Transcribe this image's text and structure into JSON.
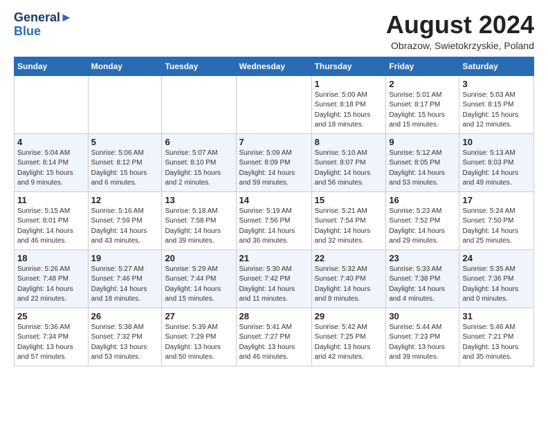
{
  "header": {
    "logo_line1": "General",
    "logo_line2": "Blue",
    "month_title": "August 2024",
    "location": "Obrazow, Swietokrzyskie, Poland"
  },
  "weekdays": [
    "Sunday",
    "Monday",
    "Tuesday",
    "Wednesday",
    "Thursday",
    "Friday",
    "Saturday"
  ],
  "weeks": [
    [
      {
        "day": "",
        "info": ""
      },
      {
        "day": "",
        "info": ""
      },
      {
        "day": "",
        "info": ""
      },
      {
        "day": "",
        "info": ""
      },
      {
        "day": "1",
        "info": "Sunrise: 5:00 AM\nSunset: 8:18 PM\nDaylight: 15 hours\nand 18 minutes."
      },
      {
        "day": "2",
        "info": "Sunrise: 5:01 AM\nSunset: 8:17 PM\nDaylight: 15 hours\nand 15 minutes."
      },
      {
        "day": "3",
        "info": "Sunrise: 5:03 AM\nSunset: 8:15 PM\nDaylight: 15 hours\nand 12 minutes."
      }
    ],
    [
      {
        "day": "4",
        "info": "Sunrise: 5:04 AM\nSunset: 8:14 PM\nDaylight: 15 hours\nand 9 minutes."
      },
      {
        "day": "5",
        "info": "Sunrise: 5:06 AM\nSunset: 8:12 PM\nDaylight: 15 hours\nand 6 minutes."
      },
      {
        "day": "6",
        "info": "Sunrise: 5:07 AM\nSunset: 8:10 PM\nDaylight: 15 hours\nand 2 minutes."
      },
      {
        "day": "7",
        "info": "Sunrise: 5:09 AM\nSunset: 8:09 PM\nDaylight: 14 hours\nand 59 minutes."
      },
      {
        "day": "8",
        "info": "Sunrise: 5:10 AM\nSunset: 8:07 PM\nDaylight: 14 hours\nand 56 minutes."
      },
      {
        "day": "9",
        "info": "Sunrise: 5:12 AM\nSunset: 8:05 PM\nDaylight: 14 hours\nand 53 minutes."
      },
      {
        "day": "10",
        "info": "Sunrise: 5:13 AM\nSunset: 8:03 PM\nDaylight: 14 hours\nand 49 minutes."
      }
    ],
    [
      {
        "day": "11",
        "info": "Sunrise: 5:15 AM\nSunset: 8:01 PM\nDaylight: 14 hours\nand 46 minutes."
      },
      {
        "day": "12",
        "info": "Sunrise: 5:16 AM\nSunset: 7:59 PM\nDaylight: 14 hours\nand 43 minutes."
      },
      {
        "day": "13",
        "info": "Sunrise: 5:18 AM\nSunset: 7:58 PM\nDaylight: 14 hours\nand 39 minutes."
      },
      {
        "day": "14",
        "info": "Sunrise: 5:19 AM\nSunset: 7:56 PM\nDaylight: 14 hours\nand 36 minutes."
      },
      {
        "day": "15",
        "info": "Sunrise: 5:21 AM\nSunset: 7:54 PM\nDaylight: 14 hours\nand 32 minutes."
      },
      {
        "day": "16",
        "info": "Sunrise: 5:23 AM\nSunset: 7:52 PM\nDaylight: 14 hours\nand 29 minutes."
      },
      {
        "day": "17",
        "info": "Sunrise: 5:24 AM\nSunset: 7:50 PM\nDaylight: 14 hours\nand 25 minutes."
      }
    ],
    [
      {
        "day": "18",
        "info": "Sunrise: 5:26 AM\nSunset: 7:48 PM\nDaylight: 14 hours\nand 22 minutes."
      },
      {
        "day": "19",
        "info": "Sunrise: 5:27 AM\nSunset: 7:46 PM\nDaylight: 14 hours\nand 18 minutes."
      },
      {
        "day": "20",
        "info": "Sunrise: 5:29 AM\nSunset: 7:44 PM\nDaylight: 14 hours\nand 15 minutes."
      },
      {
        "day": "21",
        "info": "Sunrise: 5:30 AM\nSunset: 7:42 PM\nDaylight: 14 hours\nand 11 minutes."
      },
      {
        "day": "22",
        "info": "Sunrise: 5:32 AM\nSunset: 7:40 PM\nDaylight: 14 hours\nand 8 minutes."
      },
      {
        "day": "23",
        "info": "Sunrise: 5:33 AM\nSunset: 7:38 PM\nDaylight: 14 hours\nand 4 minutes."
      },
      {
        "day": "24",
        "info": "Sunrise: 5:35 AM\nSunset: 7:36 PM\nDaylight: 14 hours\nand 0 minutes."
      }
    ],
    [
      {
        "day": "25",
        "info": "Sunrise: 5:36 AM\nSunset: 7:34 PM\nDaylight: 13 hours\nand 57 minutes."
      },
      {
        "day": "26",
        "info": "Sunrise: 5:38 AM\nSunset: 7:32 PM\nDaylight: 13 hours\nand 53 minutes."
      },
      {
        "day": "27",
        "info": "Sunrise: 5:39 AM\nSunset: 7:29 PM\nDaylight: 13 hours\nand 50 minutes."
      },
      {
        "day": "28",
        "info": "Sunrise: 5:41 AM\nSunset: 7:27 PM\nDaylight: 13 hours\nand 46 minutes."
      },
      {
        "day": "29",
        "info": "Sunrise: 5:42 AM\nSunset: 7:25 PM\nDaylight: 13 hours\nand 42 minutes."
      },
      {
        "day": "30",
        "info": "Sunrise: 5:44 AM\nSunset: 7:23 PM\nDaylight: 13 hours\nand 39 minutes."
      },
      {
        "day": "31",
        "info": "Sunrise: 5:46 AM\nSunset: 7:21 PM\nDaylight: 13 hours\nand 35 minutes."
      }
    ]
  ]
}
